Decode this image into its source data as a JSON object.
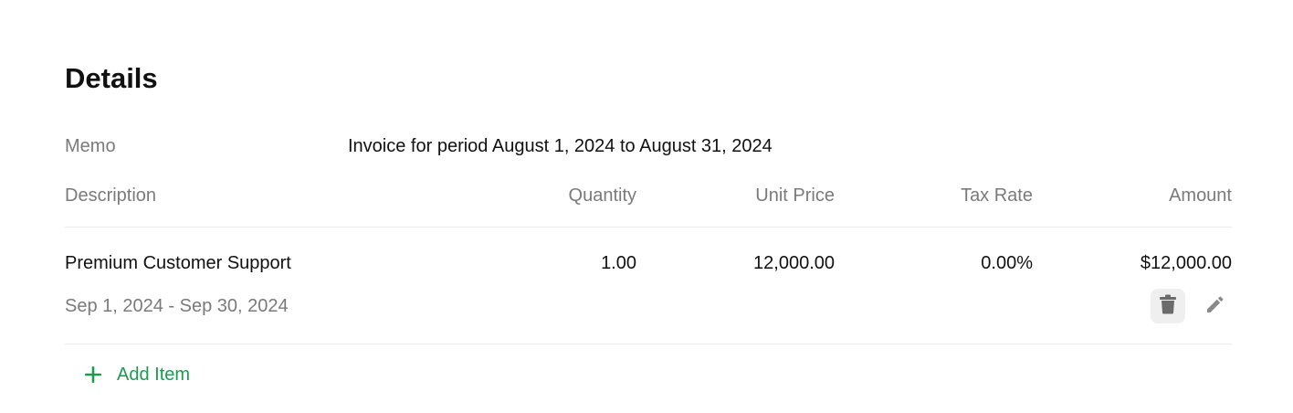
{
  "details": {
    "title": "Details",
    "memo_label": "Memo",
    "memo_value": "Invoice for period August 1, 2024 to August 31, 2024"
  },
  "table": {
    "headers": {
      "description": "Description",
      "quantity": "Quantity",
      "unit_price": "Unit Price",
      "tax_rate": "Tax Rate",
      "amount": "Amount"
    },
    "rows": [
      {
        "description": "Premium Customer Support",
        "period": "Sep 1, 2024 - Sep 30, 2024",
        "quantity": "1.00",
        "unit_price": "12,000.00",
        "tax_rate": "0.00%",
        "amount": "$12,000.00"
      }
    ]
  },
  "actions": {
    "add_item_label": "Add Item",
    "delete_icon": "trash-icon",
    "edit_icon": "pencil-icon",
    "add_icon": "plus-icon"
  },
  "colors": {
    "accent_green": "#1a9b50",
    "muted_text": "#7a7a7a",
    "icon_gray": "#6b6b6b"
  }
}
